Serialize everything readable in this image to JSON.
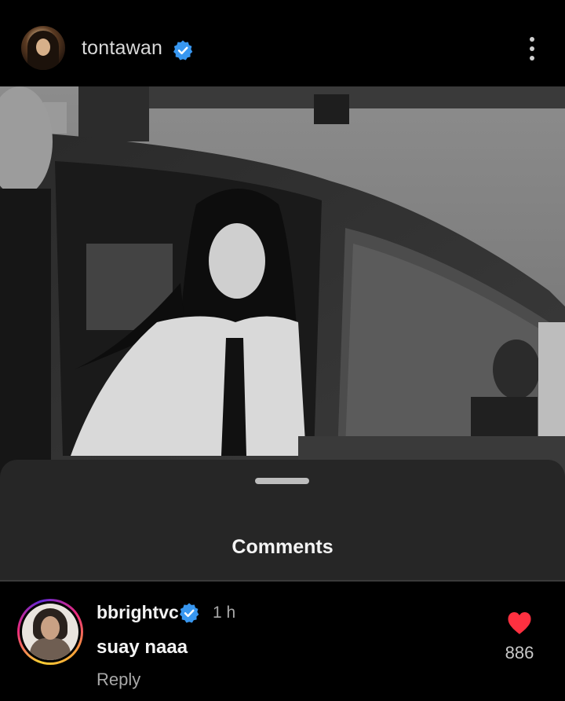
{
  "post": {
    "username": "tontawan",
    "verified": true,
    "more_icon": "more-vertical-icon"
  },
  "comments_sheet": {
    "title": "Comments"
  },
  "comments": [
    {
      "username": "bbrightvc",
      "verified": true,
      "time": "1 h",
      "text": "suay naaa",
      "reply_label": "Reply",
      "likes": "886",
      "liked": true
    }
  ],
  "colors": {
    "background": "#000000",
    "sheet": "#262626",
    "verified_badge": "#3897f0",
    "like_heart": "#ff3040",
    "secondary_text": "#a8a8a8"
  }
}
